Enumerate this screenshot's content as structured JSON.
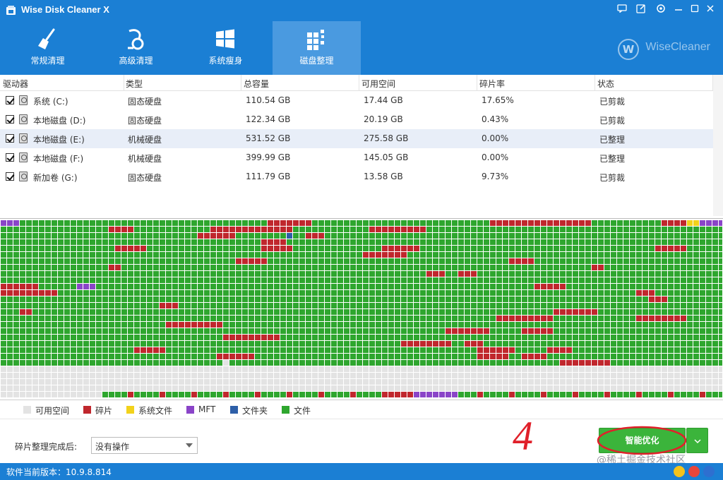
{
  "app": {
    "title": "Wise Disk Cleaner X",
    "brand": "WiseCleaner",
    "brand_mark": "W"
  },
  "window_controls": [
    "chat-icon",
    "edit-icon",
    "settings-icon",
    "minimize-icon",
    "maximize-icon",
    "close-icon"
  ],
  "nav": {
    "tabs": [
      {
        "label": "常规清理",
        "icon": "broom-icon",
        "active": false
      },
      {
        "label": "高级清理",
        "icon": "vacuum-icon",
        "active": false
      },
      {
        "label": "系统瘦身",
        "icon": "windows-icon",
        "active": false
      },
      {
        "label": "磁盘整理",
        "icon": "defrag-icon",
        "active": true
      }
    ]
  },
  "table": {
    "headers": [
      "驱动器",
      "类型",
      "总容量",
      "可用空间",
      "碎片率",
      "状态"
    ],
    "rows": [
      {
        "drive": "系统 (C:)",
        "type": "固态硬盘",
        "total": "110.54 GB",
        "free": "17.44 GB",
        "frag": "17.65%",
        "status": "已剪裁",
        "checked": true,
        "selected": false
      },
      {
        "drive": "本地磁盘 (D:)",
        "type": "固态硬盘",
        "total": "122.34 GB",
        "free": "20.19 GB",
        "frag": "0.43%",
        "status": "已剪裁",
        "checked": true,
        "selected": false
      },
      {
        "drive": "本地磁盘 (E:)",
        "type": "机械硬盘",
        "total": "531.52 GB",
        "free": "275.58 GB",
        "frag": "0.00%",
        "status": "已整理",
        "checked": true,
        "selected": true
      },
      {
        "drive": "本地磁盘 (F:)",
        "type": "机械硬盘",
        "total": "399.99 GB",
        "free": "145.05 GB",
        "frag": "0.00%",
        "status": "已整理",
        "checked": true,
        "selected": false
      },
      {
        "drive": "新加卷 (G:)",
        "type": "固态硬盘",
        "total": "111.79 GB",
        "free": "13.58 GB",
        "frag": "9.73%",
        "status": "已剪裁",
        "checked": true,
        "selected": false
      }
    ]
  },
  "legend": [
    {
      "label": "可用空间",
      "color": "#e3e3e3"
    },
    {
      "label": "碎片",
      "color": "#c0272d"
    },
    {
      "label": "系统文件",
      "color": "#f2d21b"
    },
    {
      "label": "MFT",
      "color": "#8a44c8"
    },
    {
      "label": "文件夹",
      "color": "#2e5fa8"
    },
    {
      "label": "文件",
      "color": "#2ea62e"
    }
  ],
  "after_defrag": {
    "label": "碎片整理完成后:",
    "value": "没有操作"
  },
  "action": {
    "run_label": "智能优化",
    "dropdown_icon": "chevron-down-icon"
  },
  "annotation": {
    "handwritten": "4"
  },
  "watermark": "@稀土掘金技术社区",
  "status": {
    "version": "软件当前版本：10.9.8.814",
    "icons": [
      "crown-icon",
      "weibo-icon",
      "social-icon"
    ]
  },
  "colors": {
    "primary_blue": "#1b7fd4",
    "tab_active": "#4a9ae0",
    "button_green": "#3bb43b",
    "annotation_red": "#e0202a"
  }
}
